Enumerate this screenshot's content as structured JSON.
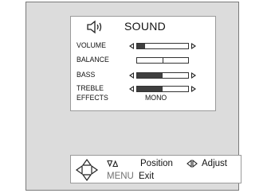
{
  "menu": {
    "title": "SOUND",
    "title_icon": "speaker-icon",
    "items": [
      {
        "label": "VOLUME",
        "type": "slider",
        "value": 0.15
      },
      {
        "label": "BALANCE",
        "type": "balance",
        "value": 0.5
      },
      {
        "label": "BASS",
        "type": "slider",
        "value": 0.5
      },
      {
        "label": "TREBLE",
        "type": "slider",
        "value": 0.5
      },
      {
        "label": "EFFECTS",
        "type": "option",
        "value_label": "MONO"
      }
    ]
  },
  "help": {
    "nav_icon": "dpad-icon",
    "position_glyph": "▽△",
    "position_label": "Position",
    "adjust_glyph": "◁▷",
    "adjust_label": "Adjust",
    "menu_key": "MENU",
    "exit_label": "Exit"
  },
  "colors": {
    "background": "#dcdcdc",
    "panel": "#ffffff",
    "bar_fill": "#3f3f3f"
  }
}
